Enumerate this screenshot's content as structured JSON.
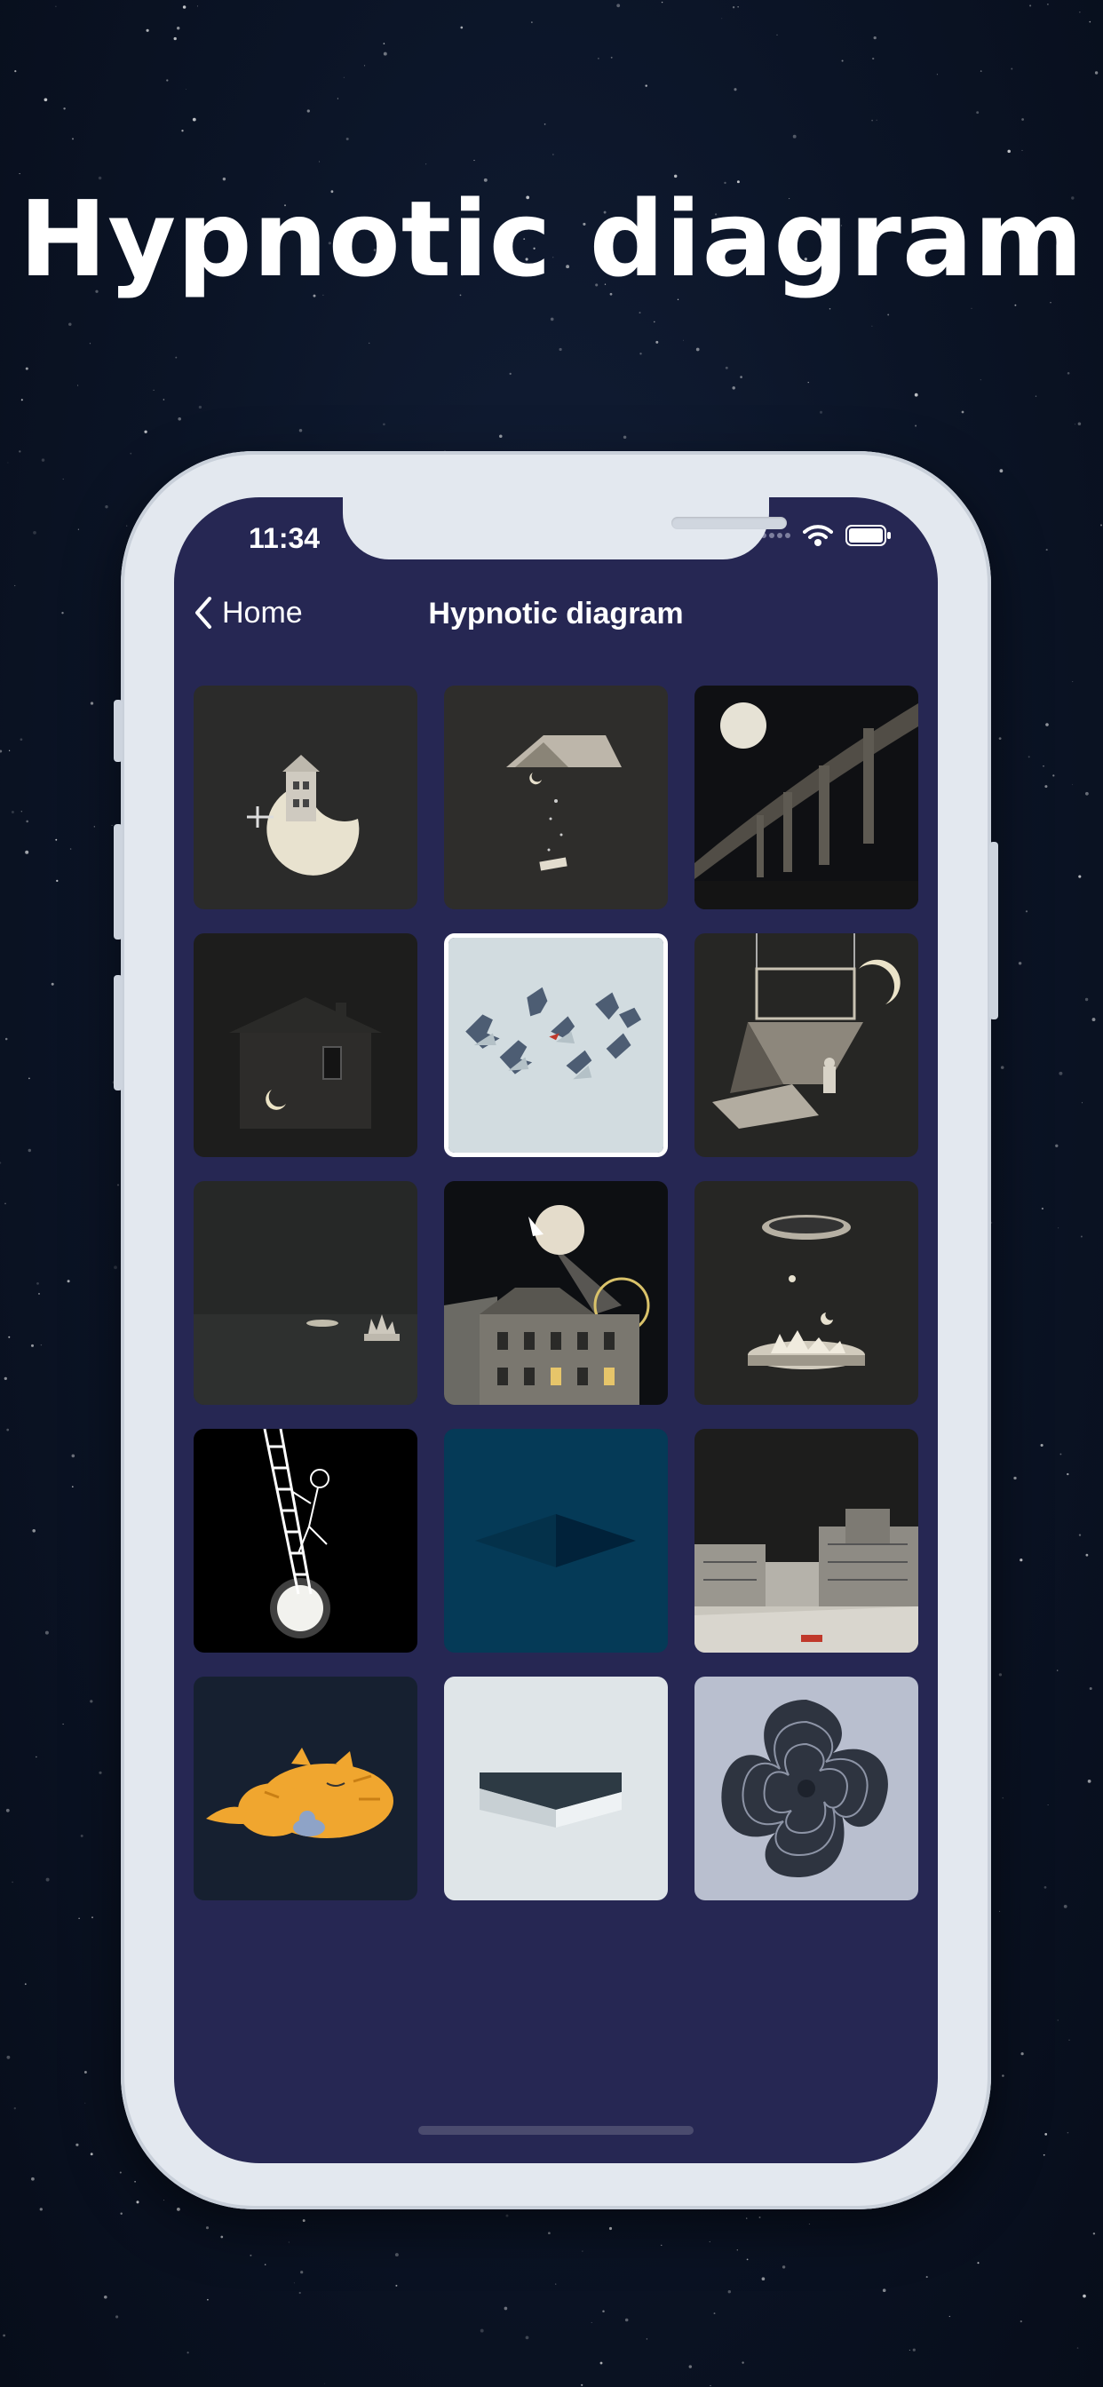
{
  "hero": {
    "title": "Hypnotic diagram"
  },
  "status_bar": {
    "time": "11:34",
    "icons": [
      "signal-icon",
      "wifi-icon",
      "battery-icon"
    ]
  },
  "nav": {
    "back_label": "Home",
    "title": "Hypnotic diagram"
  },
  "colors": {
    "screen_bg": "#262753",
    "phone_frame": "#e3e8ef",
    "background": "#0b1426"
  },
  "gallery": {
    "items": [
      {
        "name": "moon-house"
      },
      {
        "name": "flying-roof"
      },
      {
        "name": "night-bridge"
      },
      {
        "name": "dark-house-moon"
      },
      {
        "name": "shadow-hands",
        "selected": true
      },
      {
        "name": "hanging-frame-moon"
      },
      {
        "name": "dark-field"
      },
      {
        "name": "city-moon-ferris-wheel"
      },
      {
        "name": "floating-island"
      },
      {
        "name": "ladder-climber"
      },
      {
        "name": "blue-diamond"
      },
      {
        "name": "city-rooftops"
      },
      {
        "name": "sleeping-cat"
      },
      {
        "name": "folded-paper"
      },
      {
        "name": "spiral-flower"
      }
    ]
  }
}
